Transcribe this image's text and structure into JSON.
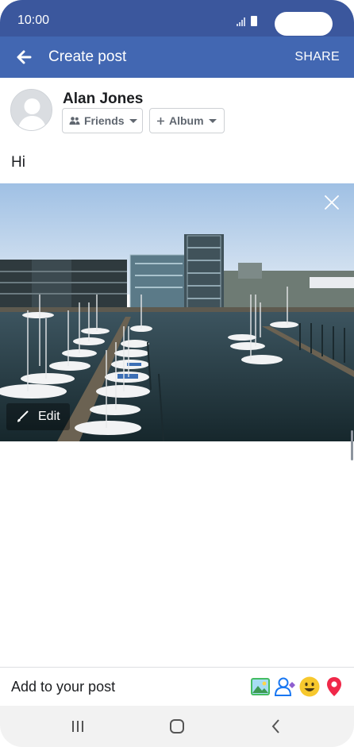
{
  "status_bar": {
    "time": "10:00"
  },
  "header": {
    "title": "Create post",
    "share_label": "SHARE",
    "back_icon": "back-arrow-icon"
  },
  "composer": {
    "user_name": "Alan Jones",
    "audience_label": "Friends",
    "album_label": "Album",
    "post_text": "Hi"
  },
  "photo": {
    "edit_label": "Edit"
  },
  "add_bar": {
    "label": "Add to your post",
    "icons": [
      "photo-icon",
      "tag-people-icon",
      "feeling-emoji-icon",
      "location-pin-icon"
    ]
  },
  "colors": {
    "brand": "#4267b2",
    "status_bar": "#3b579d"
  }
}
